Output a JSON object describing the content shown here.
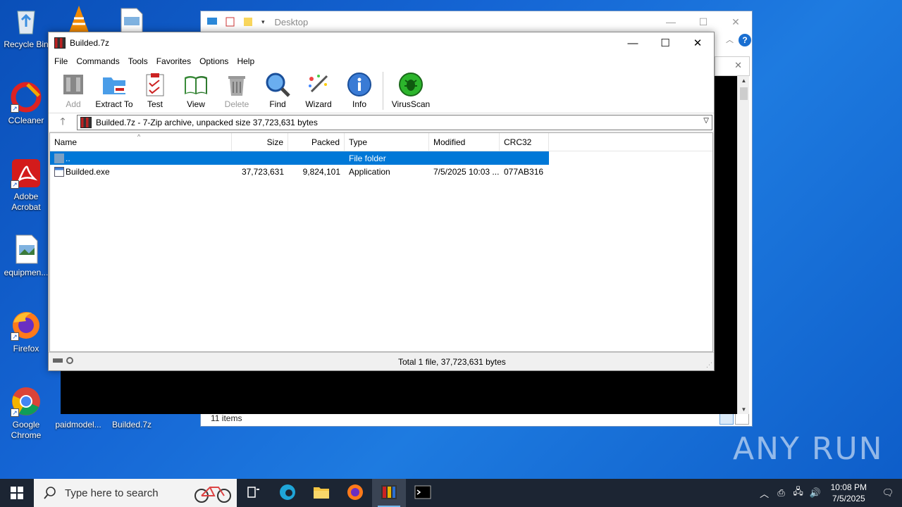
{
  "desktop": {
    "icons": [
      {
        "label": "Recycle Bin"
      },
      {
        "label": "CCleaner"
      },
      {
        "label": "Adobe Acrobat"
      },
      {
        "label": "equipmen..."
      },
      {
        "label": "Firefox"
      },
      {
        "label": "Google Chrome"
      },
      {
        "label": "paidmodel..."
      },
      {
        "label": "Builded.7z"
      }
    ]
  },
  "explorer": {
    "title": "Desktop",
    "status": "11 items"
  },
  "zip": {
    "title": "Builded.7z",
    "menu": [
      "File",
      "Commands",
      "Tools",
      "Favorites",
      "Options",
      "Help"
    ],
    "toolbar": [
      {
        "label": "Add",
        "enabled": false,
        "icon": "add-icon"
      },
      {
        "label": "Extract To",
        "enabled": true,
        "icon": "extract-icon"
      },
      {
        "label": "Test",
        "enabled": true,
        "icon": "test-icon"
      },
      {
        "label": "View",
        "enabled": true,
        "icon": "view-icon"
      },
      {
        "label": "Delete",
        "enabled": false,
        "icon": "delete-icon"
      },
      {
        "label": "Find",
        "enabled": true,
        "icon": "find-icon"
      },
      {
        "label": "Wizard",
        "enabled": true,
        "icon": "wizard-icon"
      },
      {
        "label": "Info",
        "enabled": true,
        "icon": "info-icon"
      },
      {
        "label": "VirusScan",
        "enabled": true,
        "icon": "virusscan-icon"
      }
    ],
    "address": "Builded.7z - 7-Zip archive, unpacked size 37,723,631 bytes",
    "columns": {
      "name": "Name",
      "size": "Size",
      "packed": "Packed",
      "type": "Type",
      "modified": "Modified",
      "crc": "CRC32"
    },
    "rows": [
      {
        "name": "..",
        "size": "",
        "packed": "",
        "type": "File folder",
        "modified": "",
        "crc": ""
      },
      {
        "name": "Builded.exe",
        "size": "37,723,631",
        "packed": "9,824,101",
        "type": "Application",
        "modified": "7/5/2025 10:03 ...",
        "crc": "077AB316"
      }
    ],
    "status": "Total 1 file, 37,723,631 bytes"
  },
  "taskbar": {
    "search_placeholder": "Type here to search",
    "time": "10:08 PM",
    "date": "7/5/2025"
  },
  "watermark": "ANY RUN",
  "colors": {
    "selection": "#0078d7",
    "taskbar": "#1c2533"
  }
}
